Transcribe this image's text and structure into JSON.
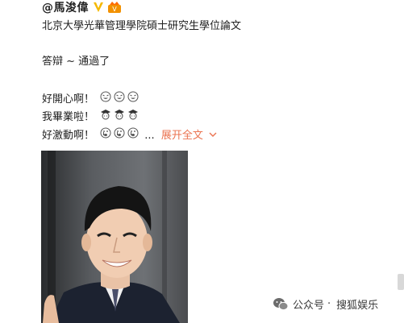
{
  "post": {
    "author": "@馬浚偉",
    "lines": [
      "北京大學光華管理學院碩士研究生學位論文",
      "答辯 ~ 通過了",
      "好開心啊！",
      "我畢業啦！",
      "好激動啊！"
    ],
    "ellipsis": "...",
    "expand_label": "展开全文",
    "icons": {
      "verified": "verified-badge-icon",
      "vip": "vip-crown-icon",
      "happy": "grin-emoji-icon",
      "graduate": "graduate-emoji-icon",
      "cry": "crying-emoji-icon",
      "expand": "chevron-down-icon"
    },
    "colors": {
      "expand": "#eb7350",
      "verified": "#f5b800"
    }
  },
  "watermark": {
    "icon": "wechat-icon",
    "prefix": "公众号",
    "separator": "·",
    "source": "搜狐娱乐"
  }
}
